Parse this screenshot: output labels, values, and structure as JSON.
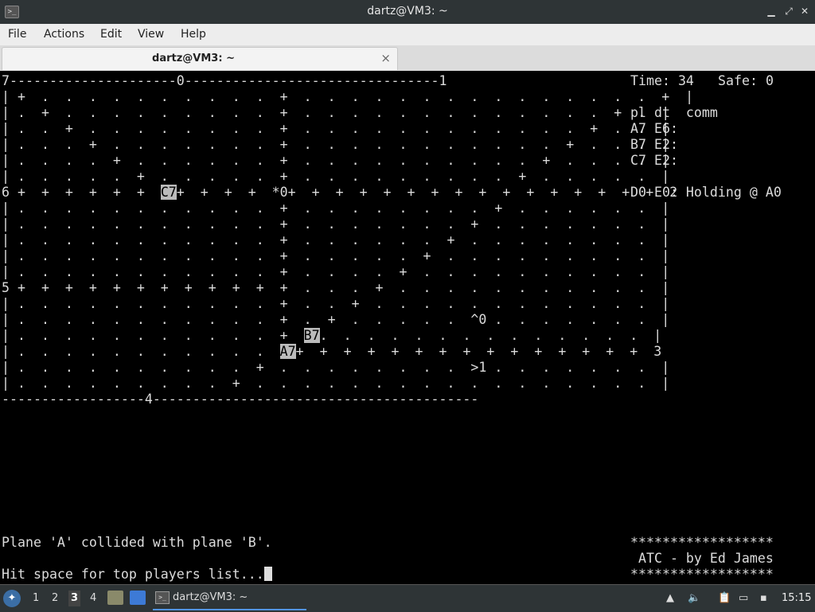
{
  "window": {
    "title": "dartz@VM3: ~"
  },
  "menu": {
    "items": [
      "File",
      "Actions",
      "Edit",
      "View",
      "Help"
    ]
  },
  "tab": {
    "label": "dartz@VM3: ~",
    "close_glyph": "×"
  },
  "atc": {
    "board_lines": [
      "7---------------------0--------------------------------1",
      "| +  .  .  .  .  .  .  .  .  .  .  +  .  .  .  .  .  .  .  .  .  .  .  .  .  .  .  +  |",
      "| .  +  .  .  .  .  .  .  .  .  .  +  .  .  .  .  .  .  .  .  .  .  .  .  .  +  .  |",
      "| .  .  +  .  .  .  .  .  .  .  .  +  .  .  .  .  .  .  .  .  .  .  .  .  +  .  .  |",
      "| .  .  .  +  .  .  .  .  .  .  .  +  .  .  .  .  .  .  .  .  .  .  .  +  .  .  .  |",
      "| .  .  .  .  +  .  .  .  .  .  .  +  .  .  .  .  .  .  .  .  .  .  +  .  .  .  .  |",
      "| .  .  .  .  .  +  .  .  .  .  .  +  .  .  .  .  .  .  .  .  .  +  .  .  .  .  .  |",
      "6 +  +  +  +  +  +  C7+  +  +  +  *0+  +  +  +  +  +  +  +  +  +  +  +  +  +  +  +  2",
      "| .  .  .  .  .  .  .  .  .  .  .  +  .  .  .  .  .  .  .  .  +  .  .  .  .  .  .  |",
      "| .  .  .  .  .  .  .  .  .  .  .  +  .  .  .  .  .  .  .  +  .  .  .  .  .  .  .  |",
      "| .  .  .  .  .  .  .  .  .  .  .  +  .  .  .  .  .  .  +  .  .  .  .  .  .  .  .  |",
      "| .  .  .  .  .  .  .  .  .  .  .  +  .  .  .  .  .  +  .  .  .  .  .  .  .  .  .  |",
      "| .  .  .  .  .  .  .  .  .  .  .  +  .  .  .  .  +  .  .  .  .  .  .  .  .  .  .  |",
      "5 +  +  +  +  +  +  +  +  +  +  +  +  .  .  .  +  .  .  .  .  .  .  .  .  .  .  .  |",
      "| .  .  .  .  .  .  .  .  .  .  .  +  .  .  +  .  .  .  .  .  .  .  .  .  .  .  .  |",
      "| .  .  .  .  .  .  .  .  .  .  .  +  .  +  .  .  .  .  .  ^0 .  .  .  .  .  .  .  |",
      "| .  .  .  .  .  .  .  .  .  .  .  +  B7.  .  .  .  .  .  .  .  .  .  .  .  .  .  |",
      "| .  .  .  .  .  .  .  .  .  .  .  A7+  +  +  +  +  +  +  +  +  +  +  +  +  +  +  3",
      "| .  .  .  .  .  .  .  .  .  .  +  .  .  .  .  .  .  .  .  >1 .  .  .  .  .  .  .  |",
      "| .  .  .  .  .  .  .  .  .  +  .  .  .  .  .  .  .  .  .  .  .  .  .  .  .  .  .  |",
      "------------------4-----------------------------------------"
    ],
    "time_label": "Time: 34",
    "safe_label": "Safe: 0",
    "header": "pl dt  comm",
    "planes": [
      "A7 E6:",
      "B7 E2:",
      "C7 E2:"
    ],
    "d0_status": "D0 E0: Holding @ A0",
    "collision_msg": "Plane 'A' collided with plane 'B'.",
    "prompt": "Hit space for top players list...",
    "stars": "******************",
    "credit": " ATC - by Ed James"
  },
  "taskbar": {
    "workspaces": [
      "1",
      "2",
      "3",
      "4"
    ],
    "active_workspace": "3",
    "task_label": "dartz@VM3: ~",
    "clock": "15:15"
  }
}
